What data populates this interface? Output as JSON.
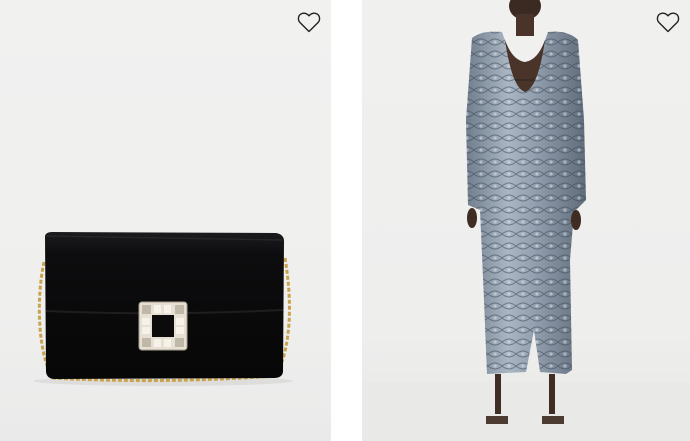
{
  "products": [
    {
      "kind": "handbag",
      "wishlist_icon": "heart-outline-icon",
      "colors": {
        "body": "#0b0b0c",
        "chain": "#c9a24f",
        "buckle": "#d8d2c6"
      }
    },
    {
      "kind": "dress",
      "wishlist_icon": "heart-outline-icon",
      "colors": {
        "fabric": "#8f9cab",
        "pattern": "#3d4754"
      }
    }
  ]
}
